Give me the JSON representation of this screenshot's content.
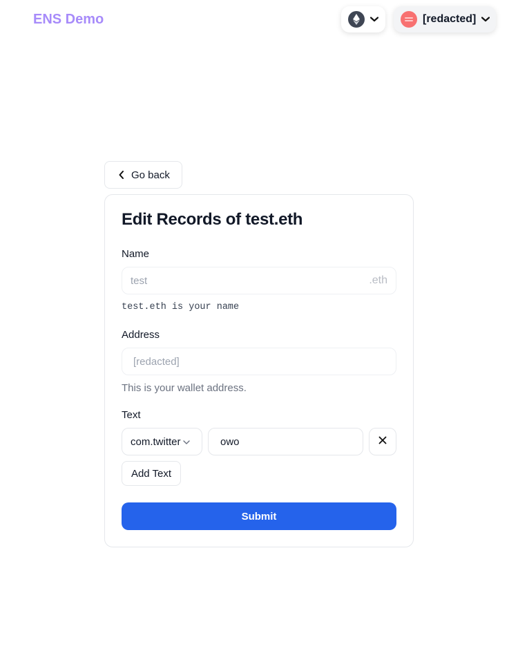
{
  "header": {
    "brand": "ENS Demo",
    "chain_icon": "ethereum-icon",
    "account_label": "[redacted]"
  },
  "go_back_label": "Go back",
  "form": {
    "title": "Edit Records of test.eth",
    "name": {
      "label": "Name",
      "placeholder": "test",
      "suffix": ".eth",
      "hint": "test.eth is your name"
    },
    "address": {
      "label": "Address",
      "placeholder": "[redacted]",
      "hint": "This is your wallet address."
    },
    "text": {
      "label": "Text",
      "selected_key": "com.twitter",
      "value": "owo",
      "add_label": "Add Text"
    },
    "submit_label": "Submit"
  },
  "colors": {
    "brand": "#a78bfa",
    "primary": "#2563eb",
    "avatar": "#f87171"
  }
}
